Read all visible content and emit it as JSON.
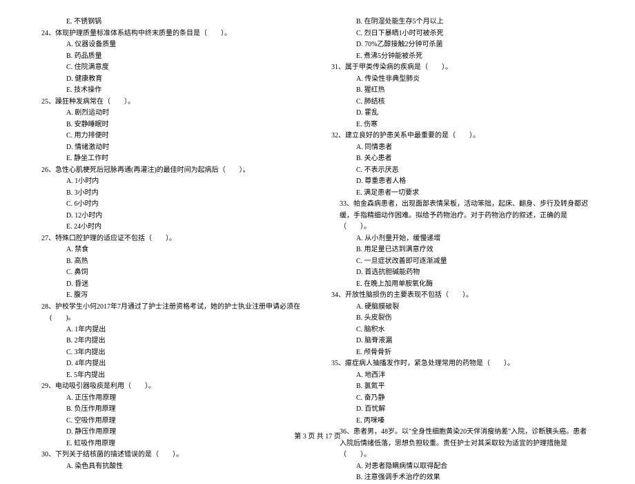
{
  "footer": "第 3 页  共 17 页",
  "left": {
    "q23_opt_e": "E. 不锈钢锅",
    "q24": "24、体现护理质量标准体系结构中终末质量的条目是（　　）。",
    "q24_opts": [
      "A. 仪器设备质量",
      "B. 药品质量",
      "C. 住院满意度",
      "D. 健康教育",
      "E. 技术操作"
    ],
    "q25": "25、躁狂种发病常在（　　）。",
    "q25_opts": [
      "A. 剧烈运动时",
      "B. 安静睡眠时",
      "C. 用力排便时",
      "D. 情绪激动时",
      "E. 静坐工作时"
    ],
    "q26": "26、急性心肌梗死后冠脉再通(再灌注)的最佳时间为起病后（　　）。",
    "q26_opts": [
      "A. 1小时内",
      "B. 3小时内",
      "C. 6小时内",
      "D. 12小时内",
      "E. 24小时内"
    ],
    "q27": "27、特殊口腔护理的适应证不包括（　　）。",
    "q27_opts": [
      "A. 禁食",
      "B. 高热",
      "C. 鼻饲",
      "D. 昏迷",
      "E. 腹泻"
    ],
    "q28": "28、护校学生小何2017年7月通过了护士注册资格考试，她的护士执业注册申请必须在(　　)。",
    "q28_opts": [
      "A. 1年内提出",
      "B. 2年内提出",
      "C. 3年内提出",
      "D. 4年内提出",
      "E. 5年内提出"
    ],
    "q29": "29、电动吸引器吸痰是利用（　　）。",
    "q29_opts": [
      "A. 正压作用原理",
      "B. 负压作用原理",
      "C. 空吸作用原理",
      "D. 静压作用原理",
      "E. 虹吸作用原理"
    ],
    "q30": "30、下列关于结核菌的描述错误的是（　　）。",
    "q30_opts": [
      "A. 染色具有抗酸性"
    ]
  },
  "right": {
    "q30_cont": [
      "B. 在阴湿处能生存5个月以上",
      "C. 烈日下暴晒1小时可被杀死",
      "D. 70%乙醇接触2分钟可杀菌",
      "E. 煮沸5分钟能被杀死"
    ],
    "q31": "31、属于甲类传染病的疾病是（　　）。",
    "q31_opts": [
      "A. 传染性非典型肺炎",
      "B. 猩红热",
      "C. 肺结核",
      "D. 霍乱",
      "E. 伤寒"
    ],
    "q32": "32、建立良好的护患关系中最重要的是（　　）。",
    "q32_opts": [
      "A. 同情患者",
      "B. 关心患者",
      "C. 不表示厌恶",
      "D. 尊重患者人格",
      "E. 满足患者一切要求"
    ],
    "q33": "33、帕金森病患者，出现面部表情呆板，活动笨拙，起床、翻身、步行及转身都迟缓，手指精细动作困难。拟给予药物治疗。对于药物治疗的叙述，正确的是（　　）。",
    "q33_opts": [
      "A. 从小剂量开始，缓慢递增",
      "B. 用足量已达到满意疗效",
      "C. 一旦症状改善即可逐渐减量",
      "D. 首选抗胆碱能药物",
      "E. 在晚上加用单胺氧化酶"
    ],
    "q34": "34、开放性脑损伤的主要表现不包括（　　）。",
    "q34_opts": [
      "A. 硬脑膜破裂",
      "B. 头皮裂伤",
      "C. 脑积水",
      "D. 脑脊液漏",
      "E. 颅骨骨折"
    ],
    "q35": "35、癔症病人抽搐发作时，紧急处理常用的药物是（　　）。",
    "q35_opts": [
      "A. 地西泮",
      "B. 氯氮平",
      "C. 奋乃静",
      "D. 百忧解",
      "E. 丙咪嗪"
    ],
    "q36": "36、患者男，48岁。以\"全身性细胞黄染20天伴消瘦纳差\"入院，诊断胰头癌。患者入院后情绪低落，思想负担较重。责任护士对其采取较为适宜的护理措施是（　　）。",
    "q36_opts": [
      "A. 对患者隐瞒病情以取得配合",
      "B. 注意强调手术治疗的效果"
    ]
  }
}
